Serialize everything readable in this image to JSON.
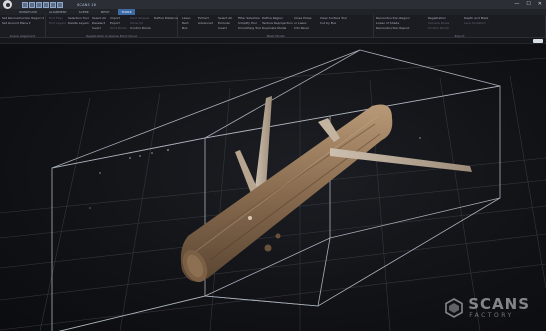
{
  "window": {
    "title": "SCANS 16",
    "controls": [
      "—",
      "☐",
      "✕"
    ]
  },
  "tabs": [
    {
      "label": "WORKFLOW",
      "active": false
    },
    {
      "label": "ALIGNMENT",
      "active": false
    },
    {
      "label": "SCENE",
      "active": false
    },
    {
      "label": "MESH",
      "active": false
    },
    {
      "label": "TOOLS",
      "active": true
    }
  ],
  "ribbon": {
    "groups": [
      {
        "label": "Scene Alignment",
        "columns": [
          {
            "items": [
              {
                "text": "Set Reconstruction Region ▾",
                "dim": false
              },
              {
                "text": "Set Ground Plane ▾",
                "dim": false
              }
            ]
          }
        ]
      },
      {
        "label": "Registration & Sparse Point Cloud",
        "columns": [
          {
            "items": [
              {
                "text": "Find Files",
                "dim": true
              },
              {
                "text": "Find Layers",
                "dim": true
              }
            ]
          },
          {
            "items": [
              {
                "text": "Selection Tool",
                "dim": false
              },
              {
                "text": "Delete Layers",
                "dim": false
              }
            ]
          },
          {
            "items": [
              {
                "text": "Select All",
                "dim": false
              },
              {
                "text": "Deselect",
                "dim": false
              },
              {
                "text": "Invert",
                "dim": false
              }
            ]
          },
          {
            "items": [
              {
                "text": "Import",
                "dim": false
              },
              {
                "text": "Export",
                "dim": false
              },
              {
                "text": "Print Points",
                "dim": true
              }
            ]
          },
          {
            "items": [
              {
                "text": "Point Shapes",
                "dim": true
              },
              {
                "text": "Show CS",
                "dim": true
              },
              {
                "text": "Control Points",
                "dim": false
              }
            ]
          },
          {
            "items": [
              {
                "text": "Define Distance",
                "dim": false
              }
            ]
          }
        ]
      },
      {
        "label": "Mesh Model",
        "columns": [
          {
            "items": [
              {
                "text": "Lasso",
                "dim": false
              },
              {
                "text": "Rect",
                "dim": false
              },
              {
                "text": "Box",
                "dim": false
              }
            ]
          },
          {
            "items": [
              {
                "text": "Extract",
                "dim": false
              },
              {
                "text": "Advanced",
                "dim": false
              }
            ]
          },
          {
            "items": [
              {
                "text": "Select All",
                "dim": false
              },
              {
                "text": "Exclude",
                "dim": false
              },
              {
                "text": "Invert",
                "dim": false
              }
            ]
          },
          {
            "items": [
              {
                "text": "Filter Selection",
                "dim": false
              },
              {
                "text": "Simplify Tool",
                "dim": false
              },
              {
                "text": "Smoothing Tool",
                "dim": false
              }
            ]
          },
          {
            "items": [
              {
                "text": "Define Region",
                "dim": false
              },
              {
                "text": "Texture Reprojection",
                "dim": false
              },
              {
                "text": "Duplicate Model",
                "dim": false
              }
            ]
          },
          {
            "items": [
              {
                "text": "Close Holes",
                "dim": false
              },
              {
                "text": "or Lasso",
                "dim": false
              },
              {
                "text": "Info Panel",
                "dim": false
              }
            ]
          },
          {
            "items": [
              {
                "text": "Clear Surface Tool",
                "dim": false
              },
              {
                "text": "Cut by Box",
                "dim": false
              }
            ]
          }
        ]
      },
      {
        "label": "Export",
        "columns": [
          {
            "items": [
              {
                "text": "Reconstruction Region",
                "dim": false
              },
              {
                "text": "Lower of Shade",
                "dim": false
              },
              {
                "text": "Reconstruction Report",
                "dim": false
              }
            ]
          },
          {
            "items": [
              {
                "text": "Registration",
                "dim": false
              },
              {
                "text": "Camera Poses",
                "dim": true
              },
              {
                "text": "Control Points",
                "dim": true
              }
            ]
          },
          {
            "items": [
              {
                "text": "Depth and Mask",
                "dim": false
              },
              {
                "text": "Lens Undistort",
                "dim": true
              }
            ]
          }
        ]
      }
    ]
  },
  "watermark": {
    "brand": "SCANS",
    "sub": "FACTORY"
  },
  "colors": {
    "accent": "#3d6aa5",
    "box_lines": "#a9b0bb",
    "grid": "#3a3d43",
    "bark": "#9b7c5d"
  }
}
